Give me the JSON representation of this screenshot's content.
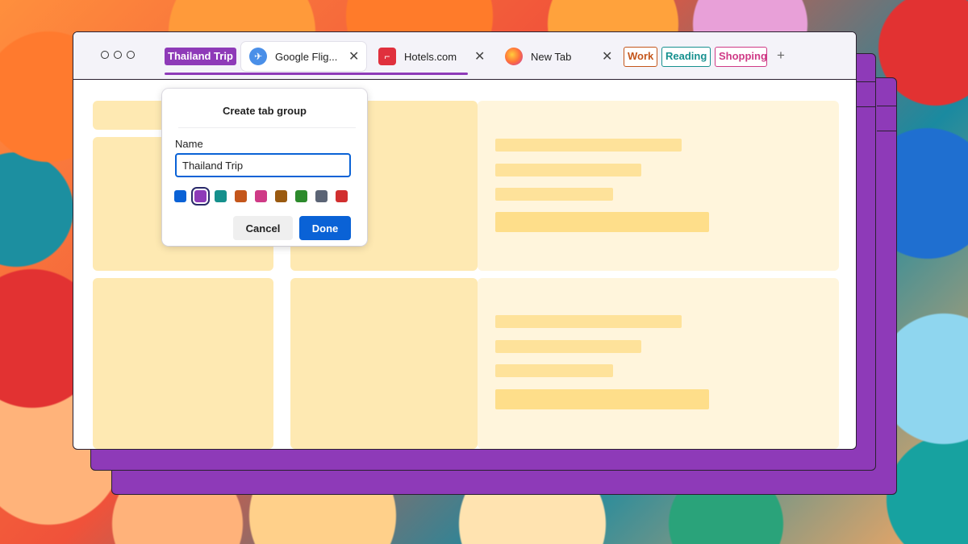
{
  "tabbar": {
    "groups": [
      {
        "label": "Thailand Trip",
        "color": "#8e3ab8"
      },
      {
        "label": "Work",
        "color": "#c4561b"
      },
      {
        "label": "Reading",
        "color": "#17918f"
      },
      {
        "label": "Shopping",
        "color": "#cf3a86"
      }
    ],
    "tabs": [
      {
        "title": "Google Flig...",
        "icon": "plane-icon",
        "active": true
      },
      {
        "title": "Hotels.com",
        "icon": "hotels-icon",
        "active": false
      },
      {
        "title": "New Tab",
        "icon": "firefox-icon",
        "active": false
      }
    ],
    "close_glyph": "✕",
    "new_tab_glyph": "+"
  },
  "dialog": {
    "title": "Create tab group",
    "name_label": "Name",
    "name_value": "Thailand Trip",
    "colors": [
      "#0a62d6",
      "#8e3ab8",
      "#15908c",
      "#c4561b",
      "#cf3a86",
      "#9a5a10",
      "#2c8a2c",
      "#5b6475",
      "#d12f2f"
    ],
    "selected_color": "#8e3ab8",
    "cancel_label": "Cancel",
    "done_label": "Done"
  }
}
